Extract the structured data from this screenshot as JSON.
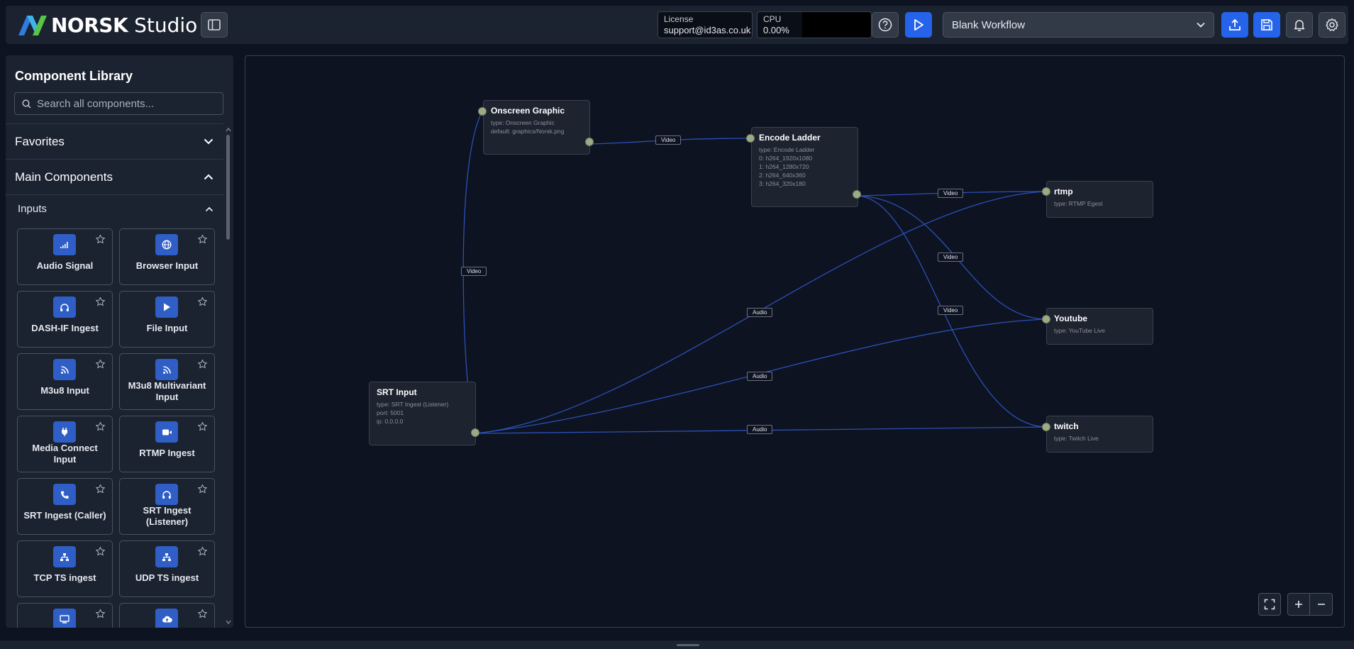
{
  "header": {
    "logo_bold": "NORSK",
    "logo_light": " Studio",
    "license_label": "License",
    "license_value": "support@id3as.co.uk",
    "cpu_label": "CPU",
    "cpu_value": "0.00%",
    "workflow": "Blank Workflow",
    "accent_color": "#2563eb"
  },
  "sidebar": {
    "title": "Component Library",
    "search_placeholder": "Search all components...",
    "favorites": "Favorites",
    "main_components": "Main Components",
    "inputs": "Inputs",
    "components": [
      {
        "name": "Audio Signal",
        "icon": "signal-bars-icon"
      },
      {
        "name": "Browser Input",
        "icon": "globe-icon"
      },
      {
        "name": "DASH-IF Ingest",
        "icon": "headphones-icon"
      },
      {
        "name": "File Input",
        "icon": "play-icon"
      },
      {
        "name": "M3u8 Input",
        "icon": "rss-icon"
      },
      {
        "name": "M3u8 Multivariant Input",
        "icon": "rss-icon"
      },
      {
        "name": "Media Connect Input",
        "icon": "plug-icon"
      },
      {
        "name": "RTMP Ingest",
        "icon": "video-camera-icon"
      },
      {
        "name": "SRT Ingest (Caller)",
        "icon": "phone-icon"
      },
      {
        "name": "SRT Ingest (Listener)",
        "icon": "headphones-icon"
      },
      {
        "name": "TCP TS ingest",
        "icon": "network-icon"
      },
      {
        "name": "UDP TS ingest",
        "icon": "network-icon"
      },
      {
        "name": "",
        "icon": "monitor-icon"
      },
      {
        "name": "",
        "icon": "cloud-upload-icon"
      }
    ]
  },
  "canvas": {
    "nodes": {
      "onscreen": {
        "title": "Onscreen Graphic",
        "lines": [
          "type: Onscreen Graphic",
          "default: graphics/Norsk.png"
        ]
      },
      "encode": {
        "title": "Encode Ladder",
        "lines": [
          "type: Encode Ladder",
          "0: h264_1920x1080",
          "1: h264_1280x720",
          "2: h264_640x360",
          "3: h264_320x180"
        ]
      },
      "rtmp": {
        "title": "rtmp",
        "lines": [
          "type: RTMP Egest"
        ]
      },
      "youtube": {
        "title": "Youtube",
        "lines": [
          "type: YouTube Live"
        ]
      },
      "twitch": {
        "title": "twitch",
        "lines": [
          "type: Twitch Live"
        ]
      },
      "srt": {
        "title": "SRT Input",
        "lines": [
          "type: SRT Ingest (Listener)",
          "port: 5001",
          "ip: 0.0.0.0"
        ]
      }
    },
    "edge_labels": {
      "video": "Video",
      "audio": "Audio"
    },
    "edge_color": "#2d4fb8"
  }
}
